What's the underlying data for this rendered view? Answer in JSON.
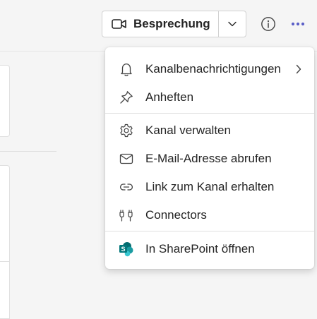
{
  "header": {
    "meeting_button_label": "Besprechung",
    "meeting_icon": "video-camera-icon",
    "dropdown_icon": "chevron-down-icon",
    "info_icon": "info-icon",
    "more_icon": "more-horizontal-icon"
  },
  "menu": {
    "items": [
      {
        "label": "Kanalbenachrichtigungen",
        "icon": "bell-icon",
        "has_submenu": true
      },
      {
        "label": "Anheften",
        "icon": "pin-icon"
      },
      {
        "label": "Kanal verwalten",
        "icon": "gear-icon"
      },
      {
        "label": "E-Mail-Adresse abrufen",
        "icon": "mail-icon"
      },
      {
        "label": "Link zum Kanal erhalten",
        "icon": "link-icon"
      },
      {
        "label": "Connectors",
        "icon": "plug-icon"
      },
      {
        "label": "In SharePoint öffnen",
        "icon": "sharepoint-icon"
      }
    ]
  },
  "colors": {
    "accent": "#5b5fc7",
    "sharepoint_dark": "#036c70",
    "sharepoint_light": "#1a9ba1",
    "text": "#242424"
  }
}
